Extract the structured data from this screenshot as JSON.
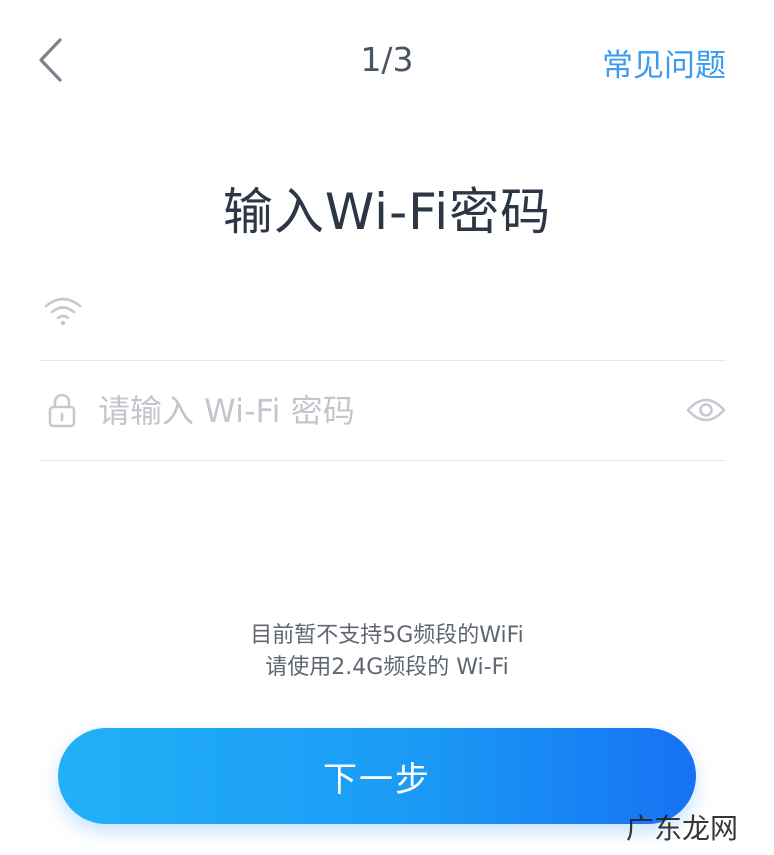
{
  "header": {
    "step_indicator": "1/3",
    "faq_label": "常见问题"
  },
  "title": "输入Wi-Fi密码",
  "wifi_field": {
    "ssid_value": ""
  },
  "password_field": {
    "placeholder": "请输入 Wi-Fi 密码",
    "value": ""
  },
  "notice": {
    "line1": "目前暂不支持5G频段的WiFi",
    "line2": "请使用2.4G频段的 Wi-Fi"
  },
  "next_button_label": "下一步",
  "watermark": "广东龙网",
  "colors": {
    "accent": "#3a9bf0",
    "button_start": "#22b0f7",
    "button_end": "#1672f3"
  },
  "icons": [
    "chevron-left-icon",
    "wifi-icon",
    "lock-icon",
    "eye-icon"
  ]
}
